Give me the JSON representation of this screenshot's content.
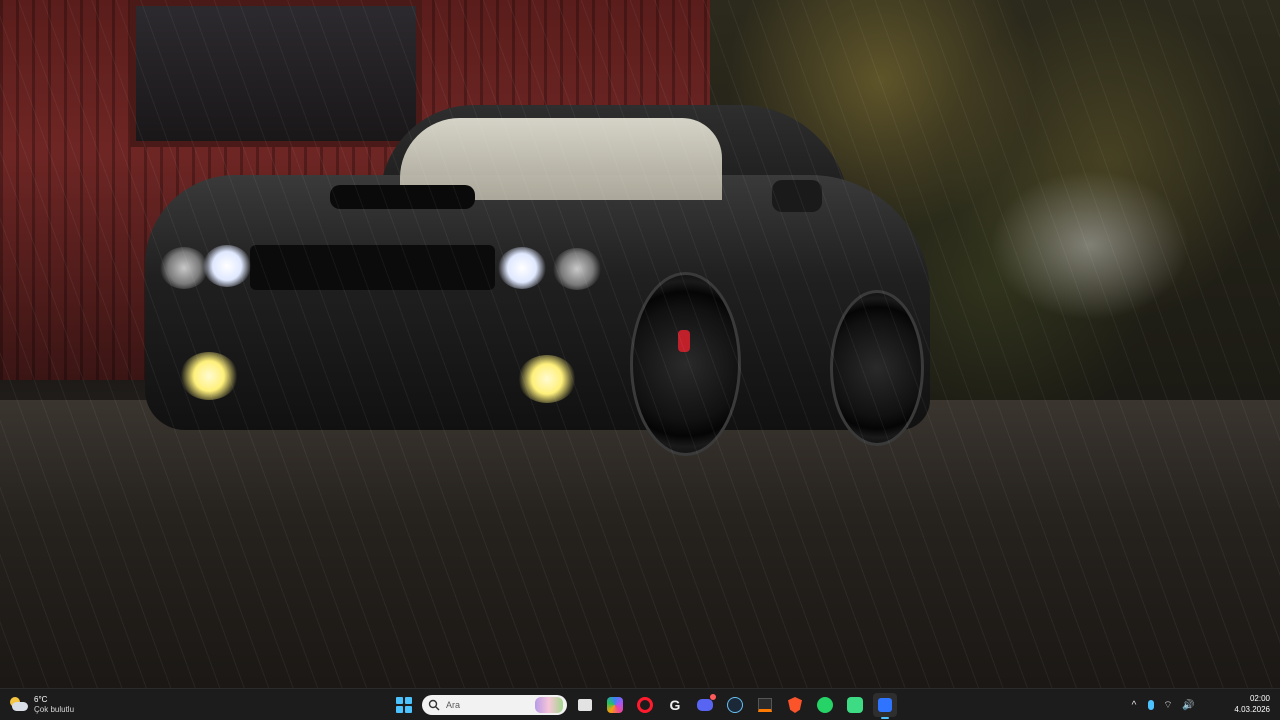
{
  "desktop": {
    "wallpaper": "wet muscle car in rain"
  },
  "taskbar": {
    "weather": {
      "icon": "partly-cloudy-icon",
      "temperature": "6°C",
      "description": "Çok bulutlu"
    },
    "search": {
      "placeholder": "Ara"
    },
    "apps": [
      {
        "name": "start-icon"
      },
      {
        "name": "file-explorer-icon"
      },
      {
        "name": "copilot-icon"
      },
      {
        "name": "opera-icon"
      },
      {
        "name": "g-app-icon"
      },
      {
        "name": "discord-icon"
      },
      {
        "name": "steam-icon"
      },
      {
        "name": "dark-app-icon"
      },
      {
        "name": "brave-icon"
      },
      {
        "name": "whatsapp-icon"
      },
      {
        "name": "android-icon"
      },
      {
        "name": "active-app-icon"
      }
    ],
    "tray": {
      "chevron": "^",
      "wifi": "⌔",
      "volume": "🔊"
    },
    "clock": {
      "time": "02:00",
      "date": "4.03.2026"
    },
    "accent_color": "#4cc2ff"
  }
}
